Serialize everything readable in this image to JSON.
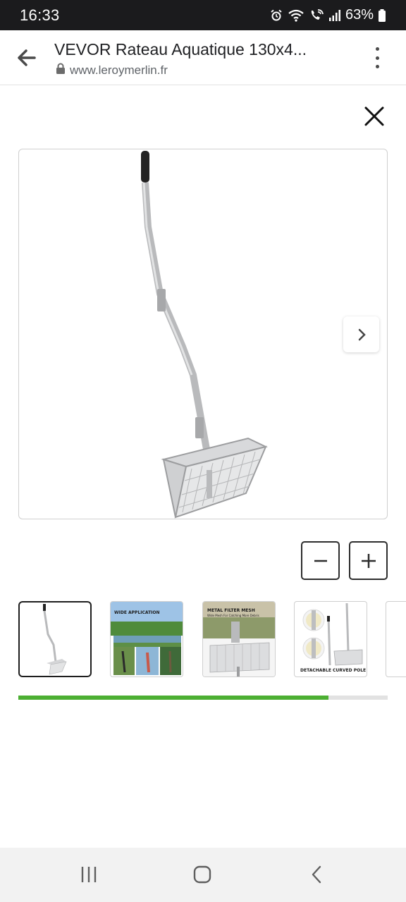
{
  "status_bar": {
    "time": "16:33",
    "battery": "63%",
    "icons": [
      "alarm-icon",
      "wifi-icon",
      "wifi-call-icon",
      "signal-icon",
      "battery-icon"
    ]
  },
  "browser": {
    "page_title": "VEVOR Rateau Aquatique 130x4...",
    "url": "www.leroymerlin.fr",
    "icons": [
      "back-arrow-icon",
      "lock-icon",
      "overflow-menu-icon"
    ]
  },
  "viewer": {
    "icons": [
      "close-icon",
      "chevron-right-icon",
      "minus-icon",
      "plus-icon"
    ],
    "thumbnails": [
      {
        "label": ""
      },
      {
        "label": "WIDE APPLICATION"
      },
      {
        "label": "METAL FILTER MESH",
        "sublabel": "Wide Mesh For Catching More Debris"
      },
      {
        "label": "DETACHABLE CURVED POLE"
      }
    ],
    "scroll_progress": 0.84
  },
  "colors": {
    "accent": "#4caf32",
    "status_bar": "#1b1b1d",
    "product_metal": "#c8c9cb"
  },
  "nav_bar": {
    "icons": [
      "recent-apps-icon",
      "home-icon",
      "back-icon"
    ]
  }
}
